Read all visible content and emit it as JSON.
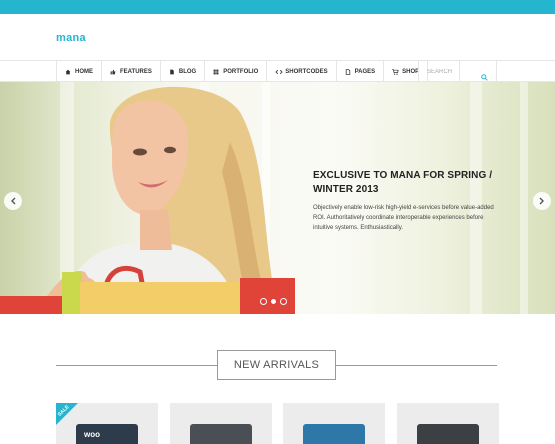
{
  "header": {
    "logo": "mana"
  },
  "nav": {
    "items": [
      {
        "label": "HOME",
        "icon": "home-icon"
      },
      {
        "label": "FEATURES",
        "icon": "thumbs-up-icon"
      },
      {
        "label": "BLOG",
        "icon": "document-icon"
      },
      {
        "label": "PORTFOLIO",
        "icon": "grid-icon"
      },
      {
        "label": "SHORTCODES",
        "icon": "code-icon"
      },
      {
        "label": "PAGES",
        "icon": "page-icon"
      },
      {
        "label": "SHOP",
        "icon": "cart-icon"
      }
    ],
    "search_placeholder": "SEARCH"
  },
  "hero": {
    "title": "EXCLUSIVE TO MANA FOR SPRING / WINTER 2013",
    "text": "Objectively enable low-risk high-yield e-services before value-added ROI. Authoritatively coordinate interoperable experiences before intuitive systems. Enthusiastically.",
    "active_slide": 2,
    "slide_count": 3
  },
  "section": {
    "title": "NEW ARRIVALS"
  },
  "products": [
    {
      "badge": "SALE",
      "color": "#2e3b4a",
      "label": "woo"
    },
    {
      "badge": "",
      "color": "#4a4f55",
      "label": ""
    },
    {
      "badge": "",
      "color": "#2d78a8",
      "label": ""
    },
    {
      "badge": "",
      "color": "#3c3f43",
      "label": ""
    }
  ],
  "colors": {
    "accent": "#25b5cf",
    "slider_dot": "#e33a3a"
  }
}
